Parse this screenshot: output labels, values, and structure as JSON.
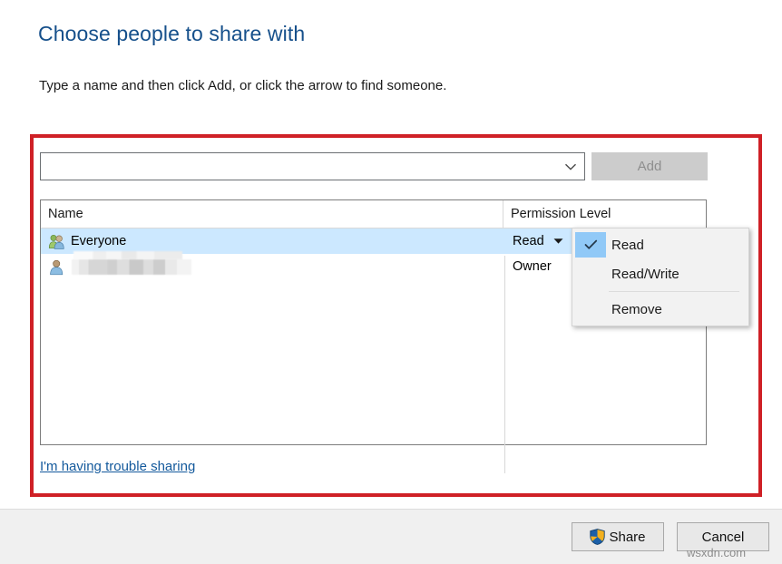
{
  "dialog": {
    "title": "Choose people to share with",
    "subtitle": "Type a name and then click Add, or click the arrow to find someone."
  },
  "entry": {
    "combo_value": "",
    "combo_placeholder": "",
    "dropdown_icon": "chevron-down-icon",
    "add_label": "Add",
    "add_enabled": false
  },
  "list": {
    "columns": [
      "Name",
      "Permission Level"
    ],
    "rows": [
      {
        "icon": "people-group-icon",
        "name": "Everyone",
        "permission": "Read",
        "has_caret": true,
        "selected": true,
        "redacted": false
      },
      {
        "icon": "single-person-icon",
        "name": "",
        "permission": "Owner",
        "has_caret": false,
        "selected": false,
        "redacted": true
      }
    ]
  },
  "permission_menu": {
    "items": [
      {
        "label": "Read",
        "checked": true,
        "separator_after": false
      },
      {
        "label": "Read/Write",
        "checked": false,
        "separator_after": true
      },
      {
        "label": "Remove",
        "checked": false,
        "separator_after": false
      }
    ]
  },
  "help_link": {
    "label": "I'm having trouble sharing"
  },
  "footer": {
    "share_label": "Share",
    "share_icon": "uac-shield-icon",
    "cancel_label": "Cancel"
  },
  "watermark": {
    "text": "wsxdn.com"
  },
  "colors": {
    "title_blue": "#16508b",
    "link_blue": "#13599c",
    "selection_blue": "#cce8ff",
    "menu_check_blue": "#91c9f7",
    "annotation_red": "#cf2026",
    "disabled_button": "#cccccc",
    "footer_bg": "#f0f0f0"
  }
}
